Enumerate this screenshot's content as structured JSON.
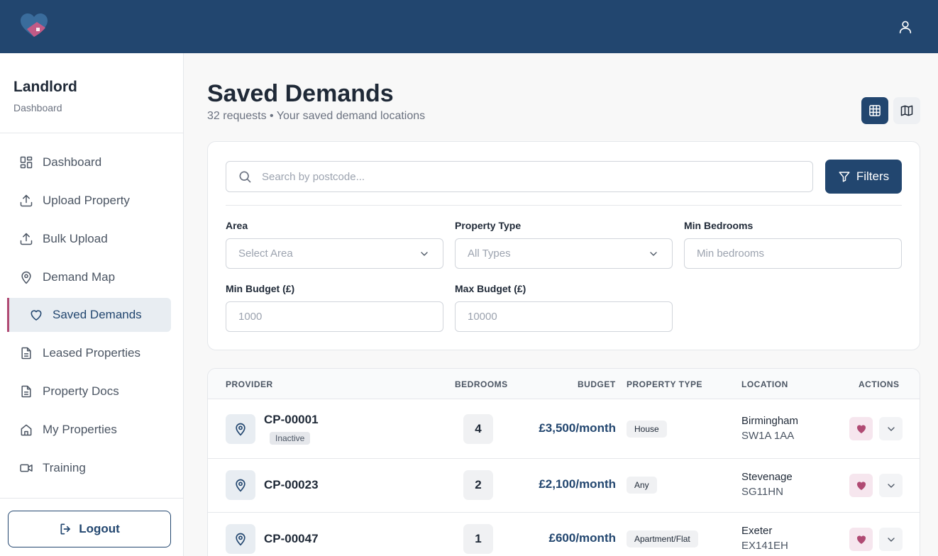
{
  "colors": {
    "brand": "#22466f",
    "accent": "#b04a73",
    "fav": "#b04a73"
  },
  "header": {
    "logo_icon": "heart-home-logo",
    "user_icon": "user-icon"
  },
  "sidebar": {
    "title": "Landlord",
    "subtitle": "Dashboard",
    "items": [
      {
        "label": "Dashboard",
        "icon": "grid-icon"
      },
      {
        "label": "Upload Property",
        "icon": "upload-icon"
      },
      {
        "label": "Bulk Upload",
        "icon": "upload-icon"
      },
      {
        "label": "Demand Map",
        "icon": "map-pin-icon"
      },
      {
        "label": "Saved Demands",
        "icon": "heart-icon",
        "active": true
      },
      {
        "label": "Leased Properties",
        "icon": "document-icon"
      },
      {
        "label": "Property Docs",
        "icon": "document-icon"
      },
      {
        "label": "My Properties",
        "icon": "home-icon"
      },
      {
        "label": "Training",
        "icon": "video-icon"
      }
    ],
    "logout_label": "Logout"
  },
  "page": {
    "title": "Saved Demands",
    "subtitle": "32 requests • Your saved demand locations",
    "view_toggle": [
      "grid-view",
      "map-view"
    ]
  },
  "filters": {
    "search_placeholder": "Search by postcode...",
    "filters_button": "Filters",
    "area_label": "Area",
    "area_value": "Select Area",
    "property_type_label": "Property Type",
    "property_type_value": "All Types",
    "min_bedrooms_label": "Min Bedrooms",
    "min_bedrooms_placeholder": "Min bedrooms",
    "min_budget_label": "Min Budget (£)",
    "min_budget_placeholder": "1000",
    "max_budget_label": "Max Budget (£)",
    "max_budget_placeholder": "10000"
  },
  "table": {
    "headers": {
      "provider": "PROVIDER",
      "bedrooms": "BEDROOMS",
      "budget": "BUDGET",
      "property_type": "PROPERTY TYPE",
      "location": "LOCATION",
      "actions": "ACTIONS"
    },
    "rows": [
      {
        "provider": "CP-00001",
        "status": "Inactive",
        "bedrooms": "4",
        "budget": "£3,500/month",
        "property_type": "House",
        "city": "Birmingham",
        "postcode": "SW1A 1AA"
      },
      {
        "provider": "CP-00023",
        "bedrooms": "2",
        "budget": "£2,100/month",
        "property_type": "Any",
        "city": "Stevenage",
        "postcode": "SG11HN"
      },
      {
        "provider": "CP-00047",
        "bedrooms": "1",
        "budget": "£600/month",
        "property_type": "Apartment/Flat",
        "city": "Exeter",
        "postcode": "EX141EH"
      }
    ]
  }
}
